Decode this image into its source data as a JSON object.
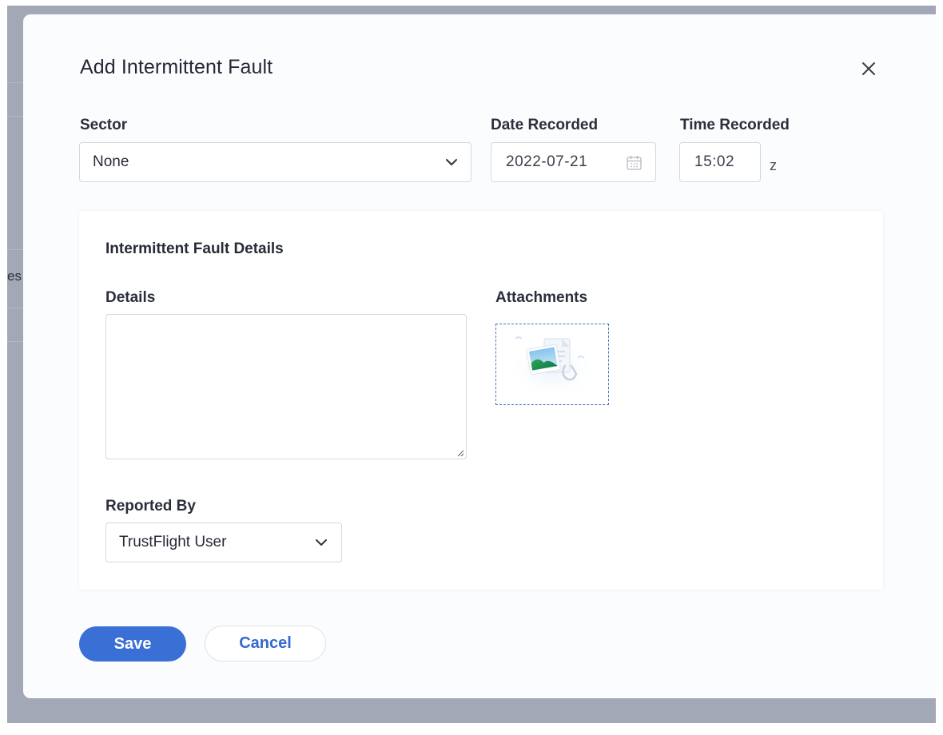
{
  "background": {
    "partial_text": "es"
  },
  "modal": {
    "title": "Add Intermittent Fault",
    "close_icon": "close-icon"
  },
  "sector": {
    "label": "Sector",
    "value": "None"
  },
  "date_recorded": {
    "label": "Date Recorded",
    "value": "2022-07-21"
  },
  "time_recorded": {
    "label": "Time Recorded",
    "value": "15:02",
    "timezone": "z"
  },
  "details_card": {
    "title": "Intermittent Fault Details",
    "details_label": "Details",
    "details_value": "",
    "attachments_label": "Attachments",
    "reported_by_label": "Reported By",
    "reported_by_value": "TrustFlight User"
  },
  "actions": {
    "save_label": "Save",
    "cancel_label": "Cancel"
  },
  "colors": {
    "primary": "#3a6fd6",
    "backdrop": "#a2a8b5",
    "attachment_border": "#4c73b7"
  }
}
